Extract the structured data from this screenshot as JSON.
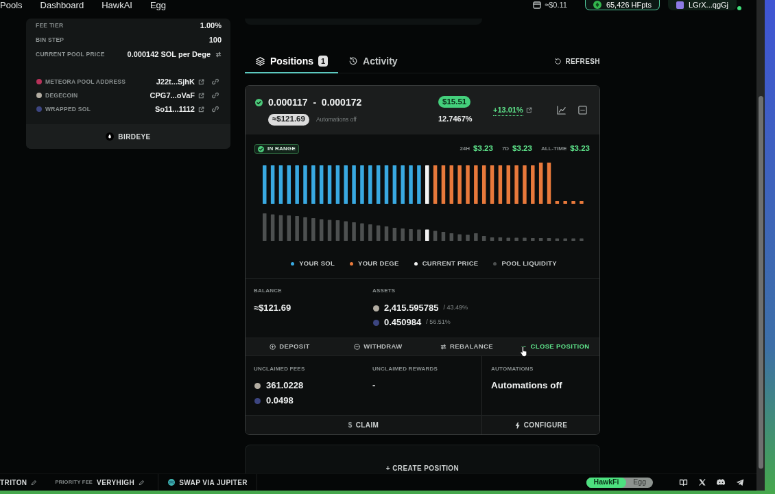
{
  "top_nav": {
    "links": [
      {
        "label": "Pools"
      },
      {
        "label": "Dashboard"
      },
      {
        "label": "HawkAI"
      },
      {
        "label": "Egg"
      }
    ],
    "balance": "≈$0.11",
    "points": "65,426 HFpts",
    "wallet": {
      "address": "LGrX...qgGj",
      "connected": true
    }
  },
  "pool_info": {
    "rows": [
      {
        "label": "FEE TIER",
        "value": "1.00%",
        "kind": "plain"
      },
      {
        "label": "BIN STEP",
        "value": "100",
        "kind": "plain"
      },
      {
        "label": "CURRENT POOL PRICE",
        "value": "0.000142 SOL per Dege",
        "kind": "price"
      }
    ],
    "addresses": [
      {
        "label": "METEORA POOL ADDRESS",
        "value": "J22t...SjhK",
        "color": "#b8325a"
      },
      {
        "label": "DEGECOIN",
        "value": "CPG7...oVaF",
        "color": "#b3ada2"
      },
      {
        "label": "WRAPPED SOL",
        "value": "So11...1112",
        "color": "#3c4580"
      }
    ],
    "link_button": "BIRDEYE"
  },
  "tabs": [
    {
      "label": "Positions",
      "badge": "1",
      "selected": true
    },
    {
      "label": "Activity",
      "selected": false
    }
  ],
  "refresh": "REFRESH",
  "position": {
    "in_range": true,
    "range": "0.000117  -  0.000172",
    "value": "≈$121.69",
    "automation_note": "Automations off",
    "earned": "$15.51",
    "apr": "12.7467%",
    "pnl": "+13.01%",
    "status": "IN RANGE",
    "earnings": [
      {
        "label": "24H",
        "value": "$3.23"
      },
      {
        "label": "7D",
        "value": "$3.23"
      },
      {
        "label": "ALL-TIME",
        "value": "$3.23"
      }
    ],
    "legend": [
      {
        "label": "YOUR SOL",
        "color": "#39a9e1"
      },
      {
        "label": "YOUR DEGE",
        "color": "#e8793b"
      },
      {
        "label": "CURRENT PRICE",
        "color": "#f4f4f4"
      },
      {
        "label": "POOL LIQUIDITY",
        "color": "#4d5050"
      }
    ],
    "balance": {
      "label": "BALANCE",
      "value": "≈$121.69"
    },
    "assets": {
      "label": "ASSETS",
      "items": [
        {
          "amount": "2,415.595785",
          "share": "/ 43.49%",
          "color": "#b3ada2"
        },
        {
          "amount": "0.450984",
          "share": "/ 56.51%",
          "color": "#3c4580"
        }
      ]
    },
    "actions": [
      {
        "label": "DEPOSIT",
        "hovered": false
      },
      {
        "label": "WITHDRAW",
        "hovered": false
      },
      {
        "label": "REBALANCE",
        "hovered": false
      },
      {
        "label": "CLOSE POSITION",
        "hovered": true
      }
    ],
    "unclaimed_fees": {
      "label": "UNCLAIMED FEES",
      "items": [
        {
          "amount": "361.0228",
          "color": "#b3ada2"
        },
        {
          "amount": "0.0498",
          "color": "#3c4580"
        }
      ]
    },
    "unclaimed_rewards": {
      "label": "UNCLAIMED REWARDS",
      "value": "-"
    },
    "automations": {
      "label": "AUTOMATIONS",
      "value": "Automations off"
    },
    "claim": {
      "glyph": "$",
      "label": "CLAIM"
    },
    "configure": "CONFIGURE"
  },
  "create_position": "+ CREATE POSITION",
  "status_bar": {
    "rpc": "TRITON",
    "priority_fee": {
      "label": "PRIORITY FEE",
      "value": "VERYHIGH"
    },
    "swap": "SWAP VIA JUPITER",
    "modes": [
      {
        "label": "HawkFi",
        "selected": true
      },
      {
        "label": "Egg",
        "selected": false
      }
    ]
  }
}
